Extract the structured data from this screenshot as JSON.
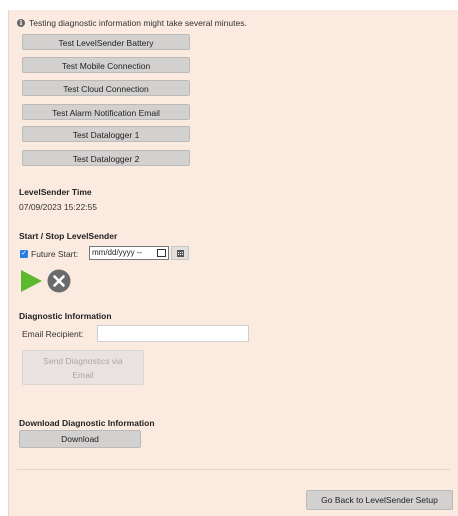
{
  "info": {
    "icon": "info-icon",
    "text": "Testing diagnostic information might take several minutes."
  },
  "tests": [
    "Test LevelSender Battery",
    "Test Mobile Connection",
    "Test Cloud Connection",
    "Test Alarm Notification Email",
    "Test Datalogger 1",
    "Test Datalogger 2"
  ],
  "time": {
    "title": "LevelSender Time",
    "value": "07/09/2023 15:22:55"
  },
  "start_stop": {
    "title": "Start / Stop LevelSender",
    "future_start_label": "Future Start:",
    "future_start_checked": true,
    "date_placeholder": "mm/dd/yyyy --",
    "play_color": "#5cb82c",
    "stop_color": "#6b6b6b"
  },
  "diagnostic": {
    "title": "Diagnostic Information",
    "email_label": "Email Recipient:",
    "email_value": "",
    "send_label_line1": "Send Diagnostics via",
    "send_label_line2": "Email"
  },
  "download": {
    "title": "Download Diagnostic Information",
    "button_label": "Download"
  },
  "footer": {
    "back_label": "Go Back to LevelSender Setup"
  },
  "colors": {
    "panel_bg": "#fbeadf",
    "button_bg": "#d3d1d0"
  }
}
